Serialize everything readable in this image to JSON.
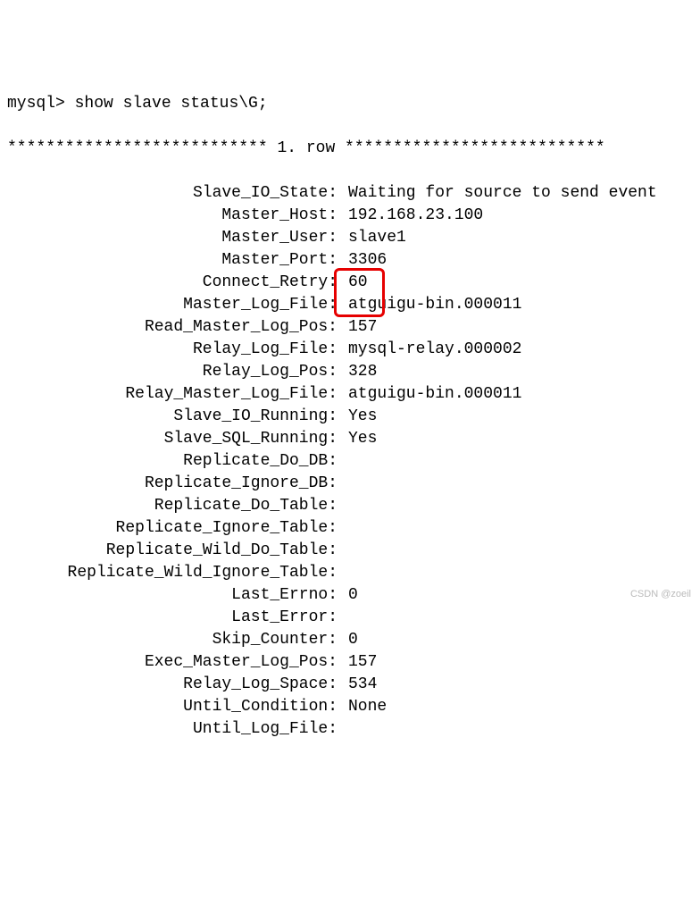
{
  "prompt": "mysql> show slave status\\G;",
  "row_header": "*************************** 1. row ***************************",
  "fields": [
    {
      "label": "Slave_IO_State:",
      "value": "Waiting for source to send event"
    },
    {
      "label": "Master_Host:",
      "value": "192.168.23.100"
    },
    {
      "label": "Master_User:",
      "value": "slave1"
    },
    {
      "label": "Master_Port:",
      "value": "3306"
    },
    {
      "label": "Connect_Retry:",
      "value": "60"
    },
    {
      "label": "Master_Log_File:",
      "value": "atguigu-bin.000011"
    },
    {
      "label": "Read_Master_Log_Pos:",
      "value": "157"
    },
    {
      "label": "Relay_Log_File:",
      "value": "mysql-relay.000002"
    },
    {
      "label": "Relay_Log_Pos:",
      "value": "328"
    },
    {
      "label": "Relay_Master_Log_File:",
      "value": "atguigu-bin.000011"
    },
    {
      "label": "Slave_IO_Running:",
      "value": "Yes"
    },
    {
      "label": "Slave_SQL_Running:",
      "value": "Yes"
    },
    {
      "label": "Replicate_Do_DB:",
      "value": ""
    },
    {
      "label": "Replicate_Ignore_DB:",
      "value": ""
    },
    {
      "label": "Replicate_Do_Table:",
      "value": ""
    },
    {
      "label": "Replicate_Ignore_Table:",
      "value": ""
    },
    {
      "label": "Replicate_Wild_Do_Table:",
      "value": ""
    },
    {
      "label": "Replicate_Wild_Ignore_Table:",
      "value": ""
    },
    {
      "label": "Last_Errno:",
      "value": "0"
    },
    {
      "label": "Last_Error:",
      "value": ""
    },
    {
      "label": "Skip_Counter:",
      "value": "0"
    },
    {
      "label": "Exec_Master_Log_Pos:",
      "value": "157"
    },
    {
      "label": "Relay_Log_Space:",
      "value": "534"
    },
    {
      "label": "Until_Condition:",
      "value": "None"
    },
    {
      "label": "Until_Log_File:",
      "value": ""
    }
  ],
  "highlight_indices": [
    10,
    11
  ],
  "watermark": "CSDN @zoeil"
}
